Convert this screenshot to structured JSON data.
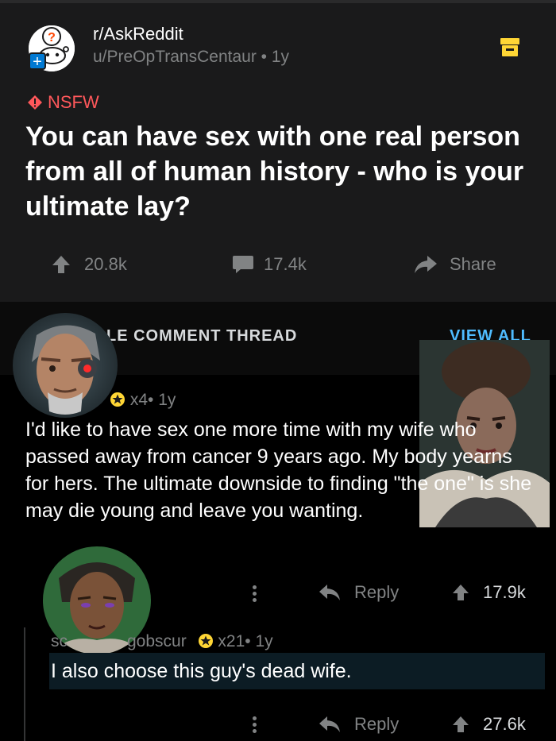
{
  "post": {
    "subreddit": "r/AskReddit",
    "author": "u/PreOpTransCentaur",
    "age": "1y",
    "nsfw_label": "NSFW",
    "title": "You can have sex with one real person from all of human history - who is your ultimate lay?",
    "upvotes": "20.8k",
    "comments": "17.4k",
    "share_label": "Share"
  },
  "thread": {
    "single_label": "LE COMMENT THREAD",
    "view_all_label": "VIEW ALL"
  },
  "comment1": {
    "author_fragment": "",
    "award_count": "x4",
    "age": "1y",
    "body": "I'd like to have sex one more time with my wife who passed away from cancer 9 years ago. My body yearns for hers. The ultimate downside to finding \"the one\" is she may die young and leave you wanting.",
    "reply_label": "Reply",
    "votes": "17.9k"
  },
  "comment2": {
    "author_left": "sc",
    "author_right": "gobscur",
    "award_count": "x21",
    "age": "1y",
    "body": "I also choose this guy's dead wife.",
    "reply_label": "Reply",
    "votes": "27.6k"
  },
  "colors": {
    "background": "#000000",
    "card": "#1a1a1b",
    "nsfw": "#ff585b",
    "link": "#4fbcff",
    "muted": "#818384",
    "award": "#ffd635"
  }
}
